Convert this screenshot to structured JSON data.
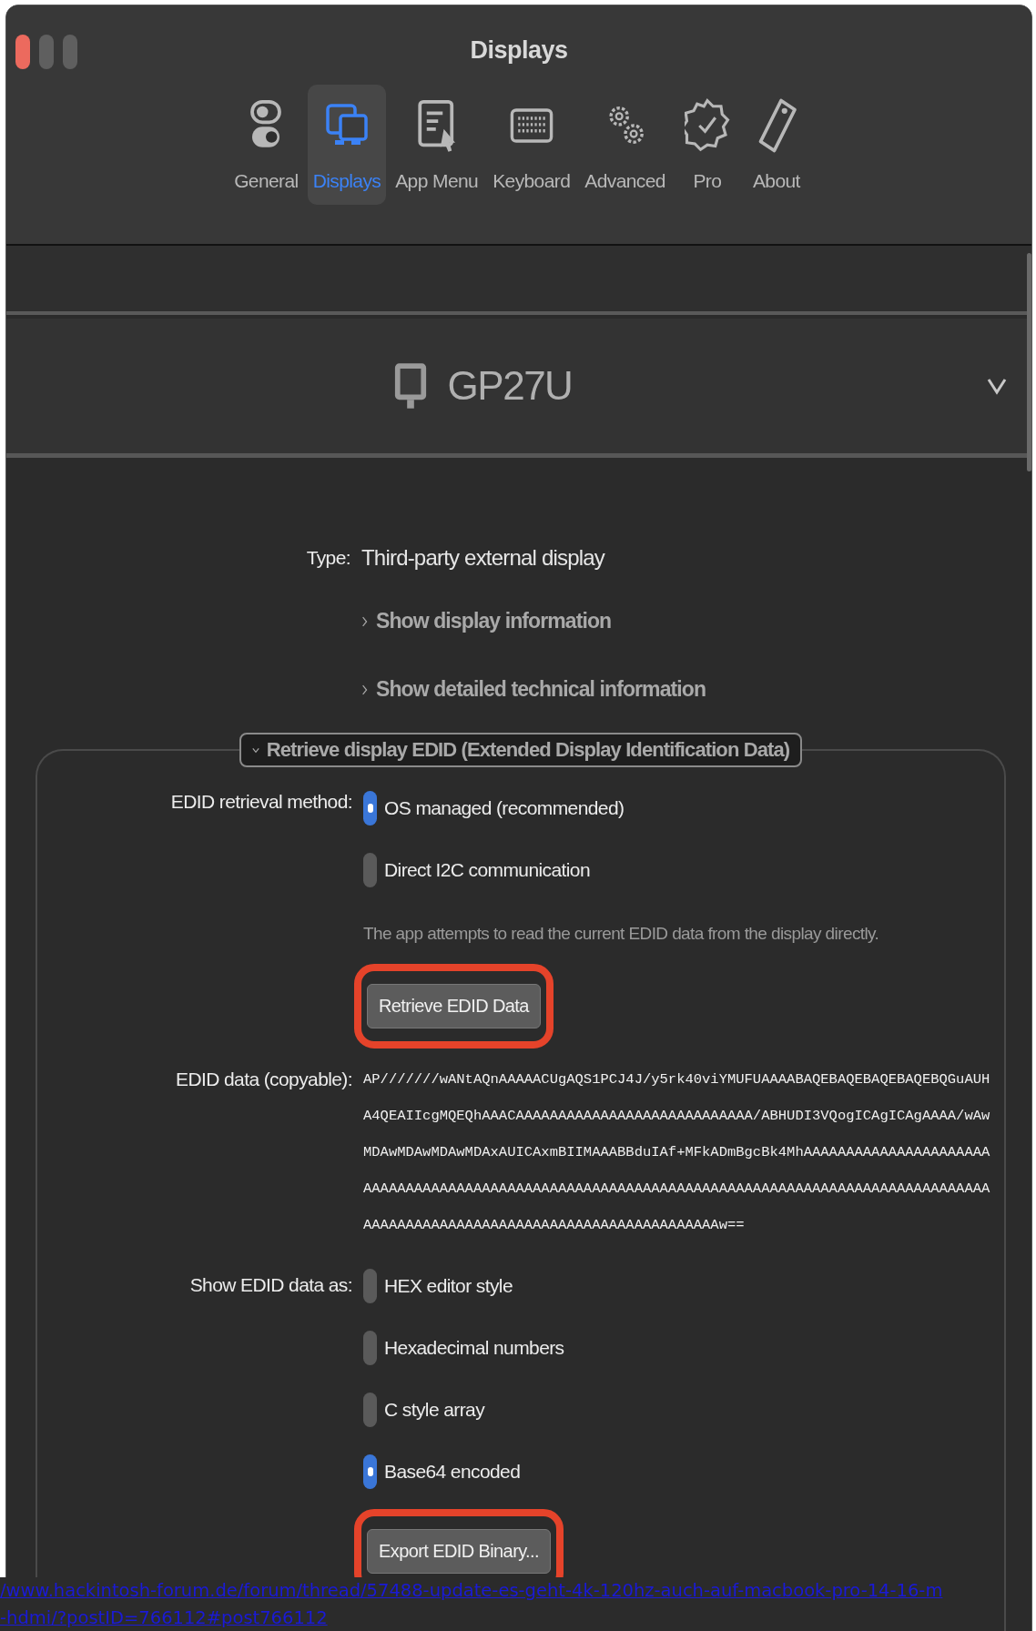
{
  "window": {
    "title": "Displays"
  },
  "tabs": [
    {
      "label": "General",
      "selected": false
    },
    {
      "label": "Displays",
      "selected": true
    },
    {
      "label": "App Menu",
      "selected": false
    },
    {
      "label": "Keyboard",
      "selected": false
    },
    {
      "label": "Advanced",
      "selected": false
    },
    {
      "label": "Pro",
      "selected": false
    },
    {
      "label": "About",
      "selected": false
    }
  ],
  "display_header": {
    "name": "GP27U"
  },
  "type": {
    "label": "Type:",
    "value": "Third-party external display"
  },
  "disclosures": [
    {
      "label": "Show display information",
      "expanded": false
    },
    {
      "label": "Show detailed technical information",
      "expanded": false
    }
  ],
  "edid_section": {
    "title": "Retrieve display EDID (Extended Display Identification Data)",
    "expanded": true,
    "method_label": "EDID retrieval method:",
    "methods": [
      {
        "label": "OS managed (recommended)",
        "selected": true
      },
      {
        "label": "Direct I2C communication",
        "selected": false
      }
    ],
    "note": "The app attempts to read the current EDID data from the display directly.",
    "retrieve_button": "Retrieve EDID Data",
    "data_label": "EDID data (copyable):",
    "data": "AP///////wANtAQnAAAAACUgAQS1PCJ4J/y5rk40viYMUFUAAAABAQEBAQEBAQEBAQEBQGuAUHA4QEAIIcgMQEQhAAACAAAAAAAAAAAAAAAAAAAAAAAAAAAA/ABHUDI3VQogICAgICAgAAAA/wAwMDAwMDAwMDAwMDAxAUICAxmBIIMAAABBduIAf+MFkADmBgcBk4MhAAAAAAAAAAAAAAAAAAAAAAAAAAAAAAAAAAAAAAAAAAAAAAAAAAAAAAAAAAAAAAAAAAAAAAAAAAAAAAAAAAAAAAAAAAAAAAAAAAAAAAAAAAAAAAAAAAAAAAAAAAAAAAAAAAAAAAAAAAw==",
    "format_label": "Show EDID data as:",
    "formats": [
      {
        "label": "HEX editor style",
        "selected": false
      },
      {
        "label": "Hexadecimal numbers",
        "selected": false
      },
      {
        "label": "C style array",
        "selected": false
      },
      {
        "label": "Base64 encoded",
        "selected": true
      }
    ],
    "export_button": "Export EDID Binary..."
  },
  "overlay_link": {
    "lines": [
      "/www.hackintosh-forum.de/forum/thread/57488-update-es-geht-4k-120hz-auch-auf-macbook-pro-14-16-m",
      "-hdmi/?postID=766112#post766112"
    ]
  }
}
